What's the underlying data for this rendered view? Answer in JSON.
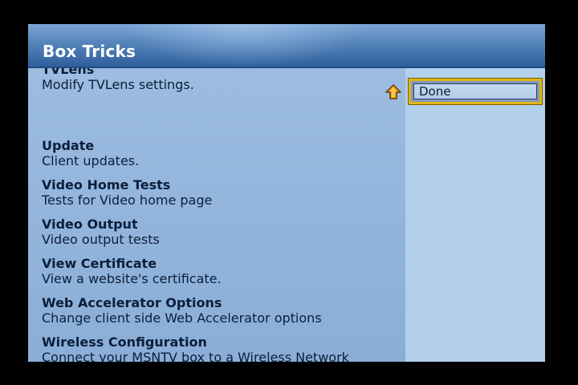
{
  "header": {
    "title": "Box Tricks"
  },
  "menu": {
    "items": [
      {
        "title": "TVLens",
        "description": "Modify TVLens settings."
      },
      {
        "title": "Update",
        "description": "Client updates."
      },
      {
        "title": "Video Home Tests",
        "description": "Tests for Video home page"
      },
      {
        "title": "Video Output",
        "description": "Video output tests"
      },
      {
        "title": "View Certificate",
        "description": "View a website's certificate."
      },
      {
        "title": "Web Accelerator Options",
        "description": "Change client side Web Accelerator options"
      },
      {
        "title": "Wireless Configuration",
        "description": "Connect your MSNTV box to a Wireless Network"
      }
    ]
  },
  "sidebar": {
    "done_label": "Done",
    "scroll_icon": "up-arrow-icon"
  },
  "colors": {
    "header": "#2f5f9c",
    "content": "#93b5dc",
    "side": "#b2cfeb",
    "focus_ring": "#e2b415",
    "up_arrow": "#f0a418"
  }
}
